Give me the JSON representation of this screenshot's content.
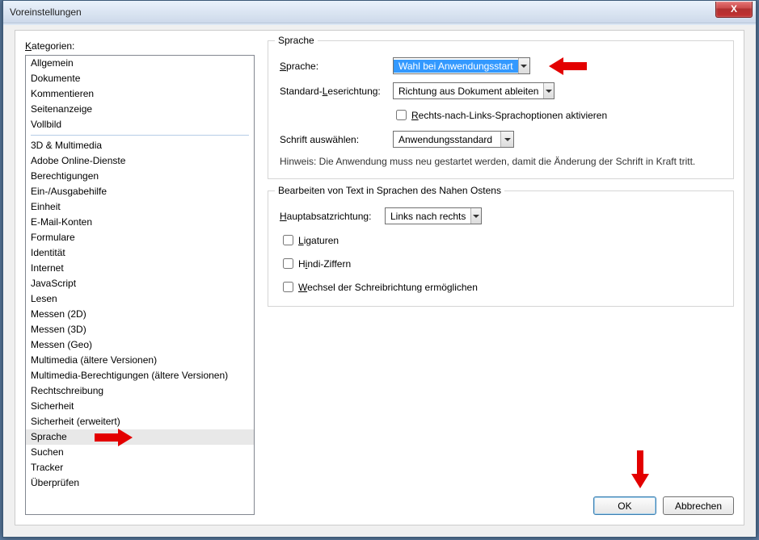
{
  "title": "Voreinstellungen",
  "close_x": "X",
  "categories_label": "Kategorien:",
  "categories_group1": [
    "Allgemein",
    "Dokumente",
    "Kommentieren",
    "Seitenanzeige",
    "Vollbild"
  ],
  "categories_group2": [
    "3D & Multimedia",
    "Adobe Online-Dienste",
    "Berechtigungen",
    "Ein-/Ausgabehilfe",
    "Einheit",
    "E-Mail-Konten",
    "Formulare",
    "Identität",
    "Internet",
    "JavaScript",
    "Lesen",
    "Messen (2D)",
    "Messen (3D)",
    "Messen (Geo)",
    "Multimedia (ältere Versionen)",
    "Multimedia-Berechtigungen (ältere Versionen)",
    "Rechtschreibung",
    "Sicherheit",
    "Sicherheit (erweitert)",
    "Sprache",
    "Suchen",
    "Tracker",
    "Überprüfen"
  ],
  "selected_category": "Sprache",
  "group1": {
    "title": "Sprache",
    "language_label": "Sprache:",
    "language_value": "Wahl bei Anwendungsstart",
    "reading_label": "Standard-Leserichtung:",
    "reading_value": "Richtung aus Dokument ableiten",
    "rtl_checkbox": "Rechts-nach-Links-Sprachoptionen aktivieren",
    "font_label": "Schrift auswählen:",
    "font_value": "Anwendungsstandard",
    "hint": "Hinweis: Die Anwendung muss neu gestartet werden, damit die Änderung der Schrift in Kraft tritt."
  },
  "group2": {
    "title": "Bearbeiten von Text in Sprachen des Nahen Ostens",
    "para_label": "Hauptabsatzrichtung:",
    "para_value": "Links nach rechts",
    "c1": "Ligaturen",
    "c2": "Hindi-Ziffern",
    "c3": "Wechsel der Schreibrichtung ermöglichen"
  },
  "buttons": {
    "ok": "OK",
    "cancel": "Abbrechen"
  }
}
